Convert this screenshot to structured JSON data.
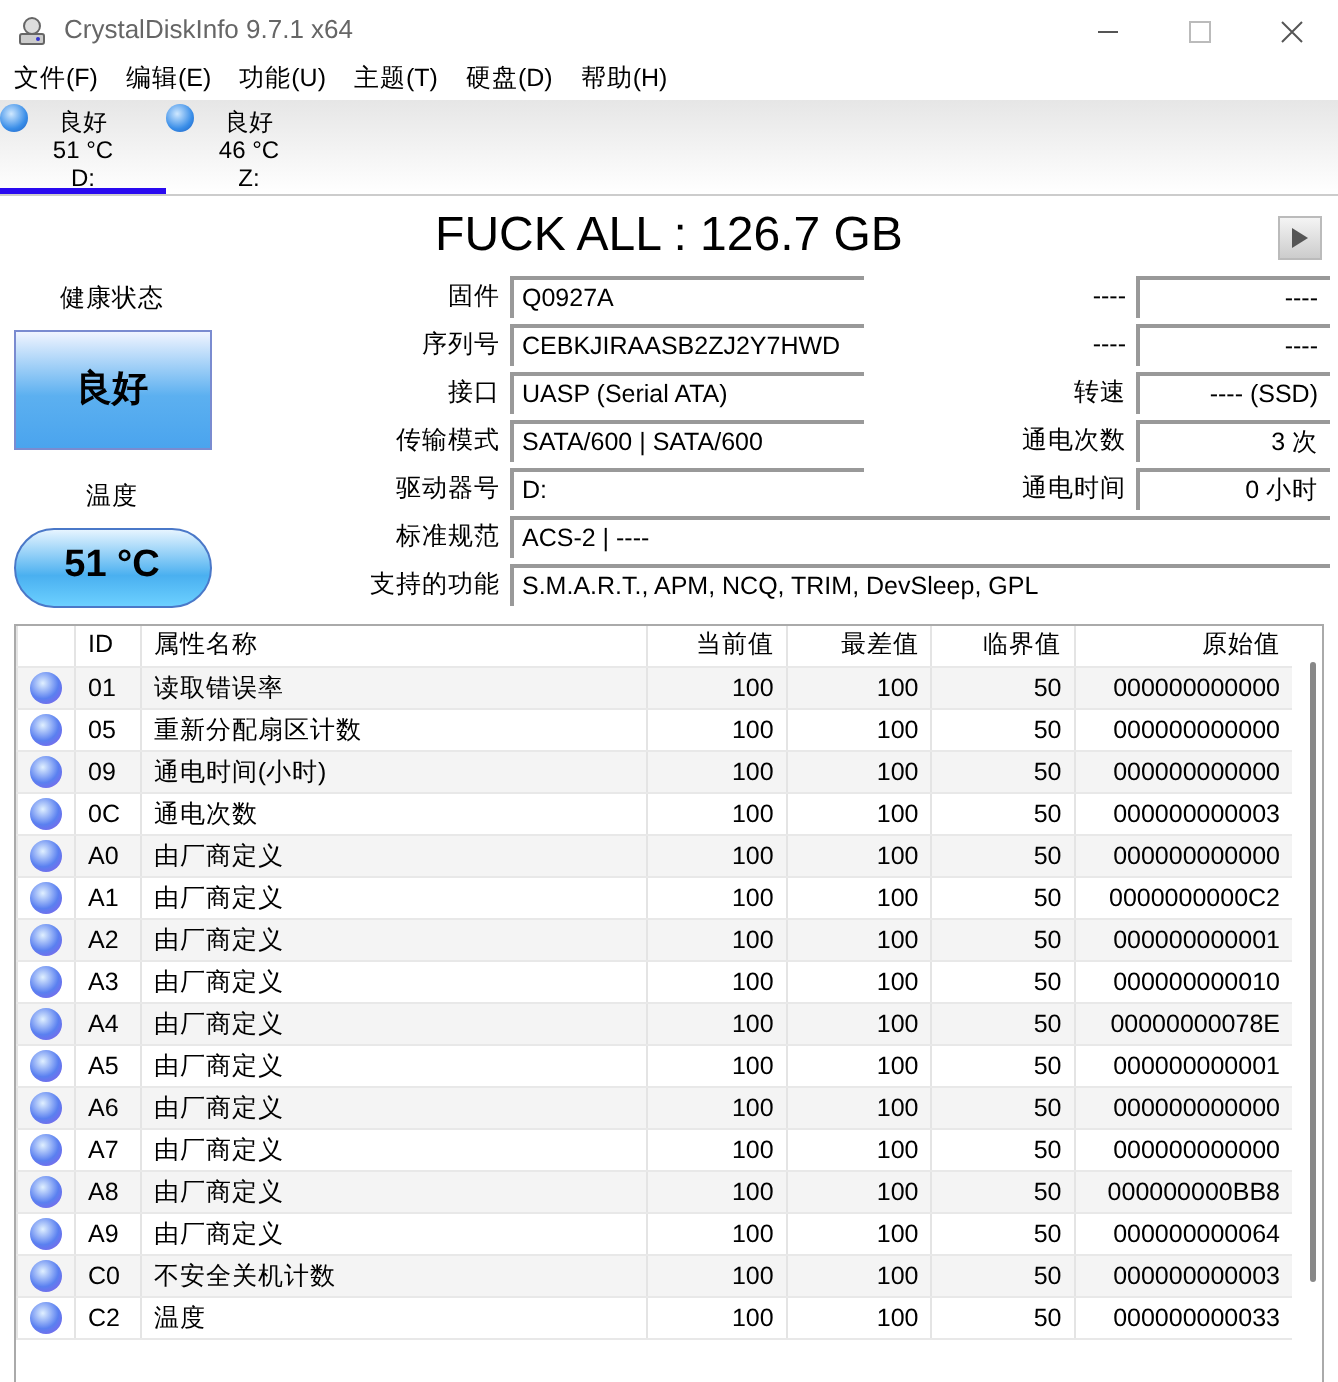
{
  "window": {
    "title": "CrystalDiskInfo 9.7.1 x64"
  },
  "menu": [
    "文件(F)",
    "编辑(E)",
    "功能(U)",
    "主题(T)",
    "硬盘(D)",
    "帮助(H)"
  ],
  "drives": [
    {
      "status": "良好",
      "temperature": "51 °C",
      "letter": "D:",
      "selected": true
    },
    {
      "status": "良好",
      "temperature": "46 °C",
      "letter": "Z:",
      "selected": false
    }
  ],
  "disk_title": "FUCK ALL : 126.7 GB",
  "health": {
    "label": "健康状态",
    "status": "良好"
  },
  "temperature": {
    "label": "温度",
    "value": "51 °C"
  },
  "info": [
    {
      "label": "固件",
      "value": "Q0927A",
      "right_label": "----",
      "right_value": "----"
    },
    {
      "label": "序列号",
      "value": "CEBKJIRAASB2ZJ2Y7HWD",
      "right_label": "----",
      "right_value": "----"
    },
    {
      "label": "接口",
      "value": "UASP (Serial ATA)",
      "right_label": "转速",
      "right_value": "---- (SSD)"
    },
    {
      "label": "传输模式",
      "value": "SATA/600 | SATA/600",
      "right_label": "通电次数",
      "right_value": "3 次"
    },
    {
      "label": "驱动器号",
      "value": "D:",
      "right_label": "通电时间",
      "right_value": "0 小时"
    },
    {
      "label": "标准规范",
      "value": "ACS-2 | ----"
    },
    {
      "label": "支持的功能",
      "value": "S.M.A.R.T., APM, NCQ, TRIM, DevSleep, GPL"
    }
  ],
  "table": {
    "columns": [
      "ID",
      "属性名称",
      "当前值",
      "最差值",
      "临界值",
      "原始值"
    ],
    "rows": [
      [
        "01",
        "读取错误率",
        "100",
        "100",
        "50",
        "000000000000"
      ],
      [
        "05",
        "重新分配扇区计数",
        "100",
        "100",
        "50",
        "000000000000"
      ],
      [
        "09",
        "通电时间(小时)",
        "100",
        "100",
        "50",
        "000000000000"
      ],
      [
        "0C",
        "通电次数",
        "100",
        "100",
        "50",
        "000000000003"
      ],
      [
        "A0",
        "由厂商定义",
        "100",
        "100",
        "50",
        "000000000000"
      ],
      [
        "A1",
        "由厂商定义",
        "100",
        "100",
        "50",
        "0000000000C2"
      ],
      [
        "A2",
        "由厂商定义",
        "100",
        "100",
        "50",
        "000000000001"
      ],
      [
        "A3",
        "由厂商定义",
        "100",
        "100",
        "50",
        "000000000010"
      ],
      [
        "A4",
        "由厂商定义",
        "100",
        "100",
        "50",
        "00000000078E"
      ],
      [
        "A5",
        "由厂商定义",
        "100",
        "100",
        "50",
        "000000000001"
      ],
      [
        "A6",
        "由厂商定义",
        "100",
        "100",
        "50",
        "000000000000"
      ],
      [
        "A7",
        "由厂商定义",
        "100",
        "100",
        "50",
        "000000000000"
      ],
      [
        "A8",
        "由厂商定义",
        "100",
        "100",
        "50",
        "000000000BB8"
      ],
      [
        "A9",
        "由厂商定义",
        "100",
        "100",
        "50",
        "000000000064"
      ],
      [
        "C0",
        "不安全关机计数",
        "100",
        "100",
        "50",
        "000000000003"
      ],
      [
        "C2",
        "温度",
        "100",
        "100",
        "50",
        "000000000033"
      ]
    ]
  }
}
